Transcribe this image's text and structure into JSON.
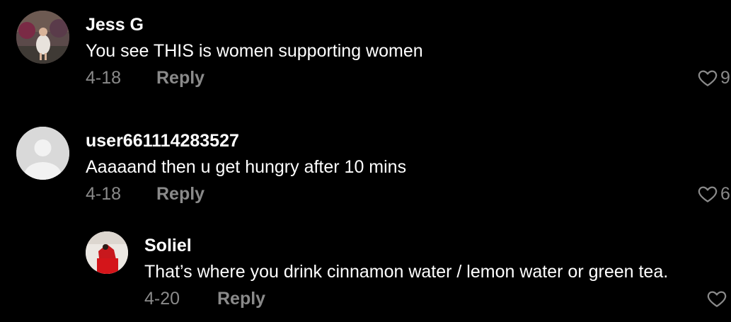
{
  "colors": {
    "background": "#000000",
    "text": "#ffffff",
    "muted": "#8a8a8a",
    "default_avatar_bg": "#d9d9d9"
  },
  "comments": [
    {
      "username": "Jess G",
      "text": "You see THIS is women supporting women",
      "date": "4-18",
      "reply_label": "Reply",
      "likes": "9",
      "avatar": "photo"
    },
    {
      "username": "user661114283527",
      "text": "Aaaaand then u get hungry after 10 mins",
      "date": "4-18",
      "reply_label": "Reply",
      "likes": "6",
      "avatar": "default"
    },
    {
      "username": "Soliel",
      "text": "That’s where you drink cinnamon water / lemon water or green tea.",
      "date": "4-20",
      "reply_label": "Reply",
      "likes": "",
      "avatar": "photo"
    }
  ]
}
